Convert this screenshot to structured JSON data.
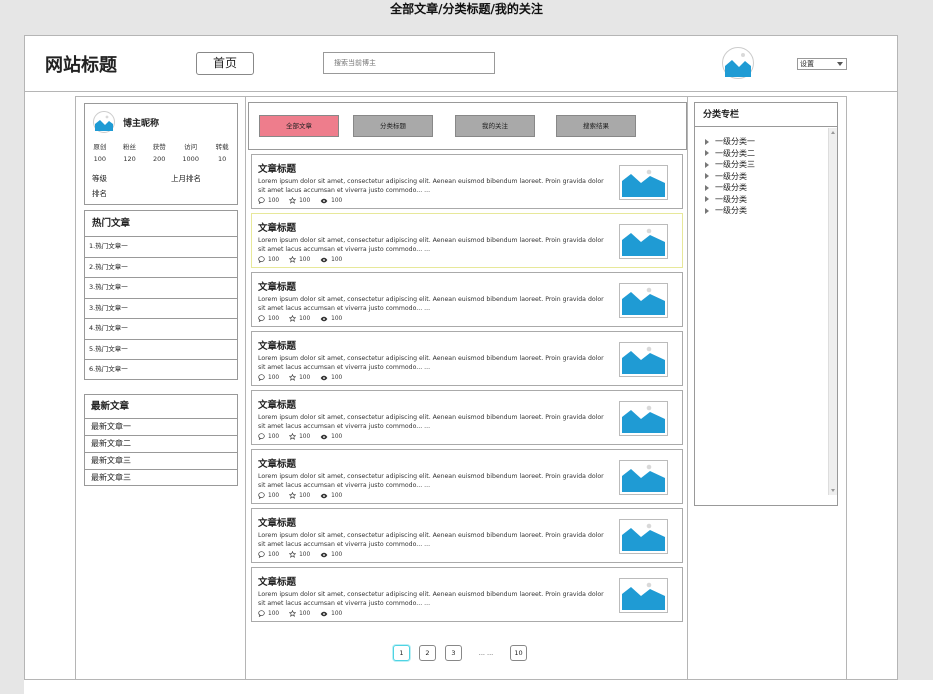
{
  "caption": "全部文章/分类标题/我的关注",
  "header": {
    "site_title": "网站标题",
    "home_label": "首页",
    "search_placeholder": "搜索当前博主",
    "settings_value": "设置"
  },
  "profile": {
    "nickname": "博主昵称",
    "stats": [
      {
        "label": "原创",
        "value": "100"
      },
      {
        "label": "粉丝",
        "value": "120"
      },
      {
        "label": "获赞",
        "value": "200"
      },
      {
        "label": "访问",
        "value": "1000"
      },
      {
        "label": "转载",
        "value": "10"
      }
    ],
    "level_label": "等级",
    "last_month_rank_label": "上月排名",
    "rank_label": "排名"
  },
  "hot": {
    "title": "热门文章",
    "items": [
      "1.热门文章一",
      "2.热门文章一",
      "3.热门文章一",
      "3.热门文章一",
      "4.热门文章一",
      "5.热门文章一",
      "6.热门文章一"
    ]
  },
  "latest": {
    "title": "最新文章",
    "items": [
      "最新文章一",
      "最新文章二",
      "最新文章三",
      "最新文章三"
    ]
  },
  "tabs": [
    "全部文章",
    "分类标题",
    "我的关注",
    "搜索结果"
  ],
  "articles": [
    {
      "title": "文章标题",
      "summary": "Lorem ipsum dolor sit amet, consectetur adipiscing elit. Aenean euismod bibendum laoreet. Proin gravida dolor sit amet lacus accumsan et viverra justo commodo... ...",
      "comments": "100",
      "stars": "100",
      "views": "100"
    },
    {
      "title": "文章标题",
      "summary": "Lorem ipsum dolor sit amet, consectetur adipiscing elit. Aenean euismod bibendum laoreet. Proin gravida dolor sit amet lacus accumsan et viverra justo commodo... ...",
      "comments": "100",
      "stars": "100",
      "views": "100"
    },
    {
      "title": "文章标题",
      "summary": "Lorem ipsum dolor sit amet, consectetur adipiscing elit. Aenean euismod bibendum laoreet. Proin gravida dolor sit amet lacus accumsan et viverra justo commodo... ...",
      "comments": "100",
      "stars": "100",
      "views": "100"
    },
    {
      "title": "文章标题",
      "summary": "Lorem ipsum dolor sit amet, consectetur adipiscing elit. Aenean euismod bibendum laoreet. Proin gravida dolor sit amet lacus accumsan et viverra justo commodo... ...",
      "comments": "100",
      "stars": "100",
      "views": "100"
    },
    {
      "title": "文章标题",
      "summary": "Lorem ipsum dolor sit amet, consectetur adipiscing elit. Aenean euismod bibendum laoreet. Proin gravida dolor sit amet lacus accumsan et viverra justo commodo... ...",
      "comments": "100",
      "stars": "100",
      "views": "100"
    },
    {
      "title": "文章标题",
      "summary": "Lorem ipsum dolor sit amet, consectetur adipiscing elit. Aenean euismod bibendum laoreet. Proin gravida dolor sit amet lacus accumsan et viverra justo commodo... ...",
      "comments": "100",
      "stars": "100",
      "views": "100"
    },
    {
      "title": "文章标题",
      "summary": "Lorem ipsum dolor sit amet, consectetur adipiscing elit. Aenean euismod bibendum laoreet. Proin gravida dolor sit amet lacus accumsan et viverra justo commodo... ...",
      "comments": "100",
      "stars": "100",
      "views": "100"
    },
    {
      "title": "文章标题",
      "summary": "Lorem ipsum dolor sit amet, consectetur adipiscing elit. Aenean euismod bibendum laoreet. Proin gravida dolor sit amet lacus accumsan et viverra justo commodo... ...",
      "comments": "100",
      "stars": "100",
      "views": "100"
    }
  ],
  "pagination": {
    "pages": [
      "1",
      "2",
      "3"
    ],
    "ellipsis": "... ...",
    "last": "10"
  },
  "categories": {
    "title": "分类专栏",
    "items": [
      "一级分类一",
      "一级分类二",
      "一级分类三",
      "一级分类",
      "一级分类",
      "一级分类",
      "一级分类"
    ]
  },
  "colors": {
    "active_tab": "#ee7d8c",
    "inactive_tab": "#a9a9a9",
    "image_blue": "#1f9bd4",
    "active_page_border": "#4fd3e3",
    "selected_article_border": "#e7e89a"
  }
}
